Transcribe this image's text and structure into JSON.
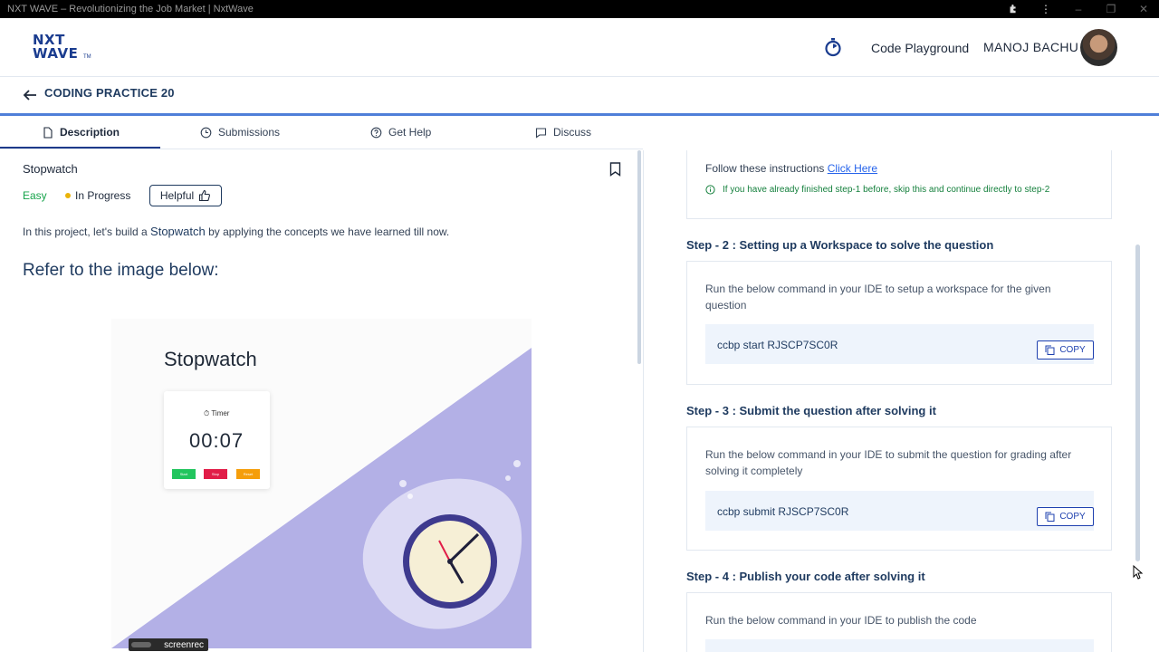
{
  "window": {
    "title": "NXT WAVE – Revolutionizing the Job Market | NxtWave"
  },
  "header": {
    "logo_line1": "NXT",
    "logo_line2": "WAVE",
    "logo_tm": "TM",
    "playground_label": "Code Playground",
    "username": "MANOJ BACHU"
  },
  "subheader": {
    "title": "CODING PRACTICE 20"
  },
  "tabs": [
    {
      "label": "Description",
      "icon": "document-icon"
    },
    {
      "label": "Submissions",
      "icon": "clock-icon"
    },
    {
      "label": "Get Help",
      "icon": "help-circle-icon"
    },
    {
      "label": "Discuss",
      "icon": "chat-icon"
    }
  ],
  "problem": {
    "title": "Stopwatch",
    "difficulty": "Easy",
    "status": "In Progress",
    "helpful_label": "Helpful",
    "intro_before": "In this project, let's build a ",
    "intro_highlight": "Stopwatch",
    "intro_after": " by applying the concepts we have learned till now.",
    "refer_heading": "Refer to the image below:"
  },
  "preview": {
    "title": "Stopwatch",
    "timer_label": "Timer",
    "time": "00:07",
    "buttons": [
      {
        "label": "Start",
        "color": "#22c55e"
      },
      {
        "label": "Stop",
        "color": "#e11d48"
      },
      {
        "label": "Reset",
        "color": "#f59e0b"
      }
    ],
    "watermark": "screenrec"
  },
  "instructions": {
    "follow_text": "Follow these instructions ",
    "follow_link": "Click Here",
    "info_text": "If you have already finished step-1 before, skip this and continue directly to step-2",
    "steps": [
      {
        "heading": "Step - 2 : Setting up a Workspace to solve the question",
        "desc": "Run the below command in your IDE to setup a workspace for the given question",
        "command": "ccbp start RJSCP7SC0R",
        "copy_label": "COPY"
      },
      {
        "heading": "Step - 3 : Submit the question after solving it",
        "desc": "Run the below command in your IDE to submit the question for grading after solving it completely",
        "command": "ccbp submit RJSCP7SC0R",
        "copy_label": "COPY"
      },
      {
        "heading": "Step - 4 : Publish your code after solving it",
        "desc": "Run the below command in your IDE to publish the code"
      }
    ]
  },
  "colors": {
    "brand": "#1a3c8f",
    "accent_bar": "#4f7fd9",
    "easy": "#16a34a",
    "in_progress_dot": "#eab308",
    "link": "#2563eb",
    "preview_lavender": "#b3b0e6"
  }
}
